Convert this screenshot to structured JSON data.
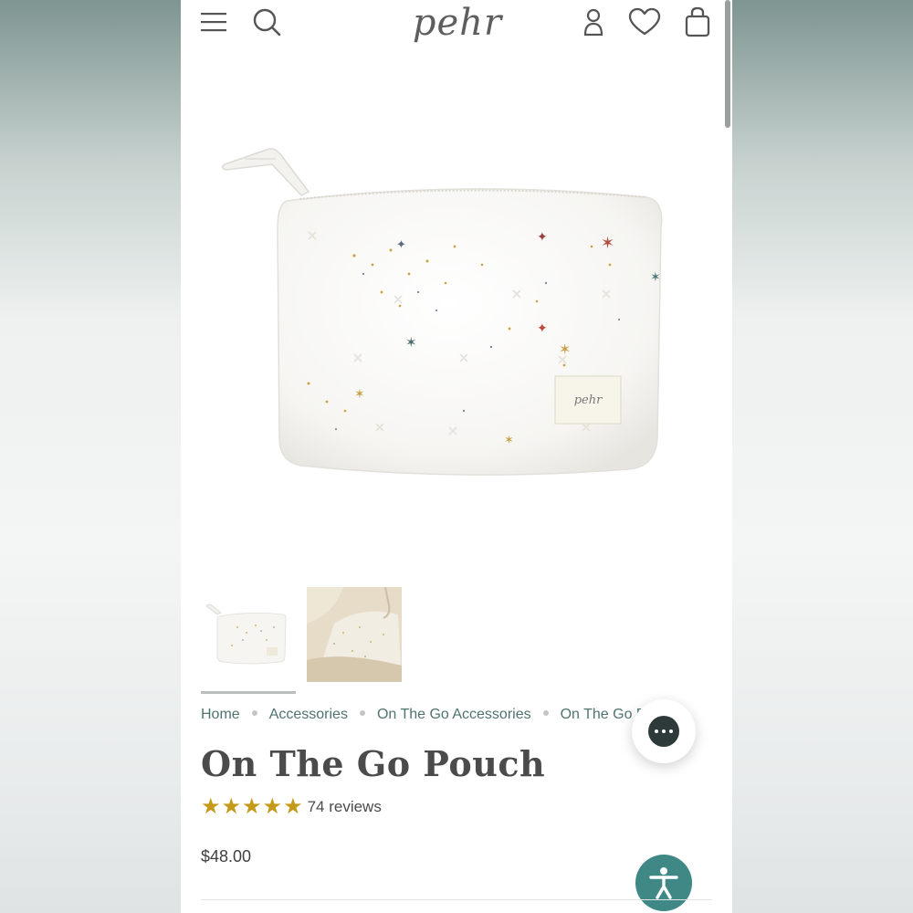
{
  "header": {
    "logo": "pehr",
    "icons": [
      "menu-icon",
      "search-icon",
      "account-icon",
      "heart-icon",
      "bag-icon"
    ]
  },
  "product": {
    "label_text": "pehr",
    "thumbnails": [
      "pouch-front",
      "pouch-lifestyle"
    ],
    "breadcrumb": [
      "Home",
      "Accessories",
      "On The Go Accessories",
      "On The Go Pouch"
    ],
    "title": "On The Go Pouch",
    "rating": 5,
    "reviews": "74 reviews",
    "price": "$48.00"
  },
  "colors": {
    "accent": "#3f8886",
    "link": "#4f7470",
    "star": "#c59a1b"
  }
}
